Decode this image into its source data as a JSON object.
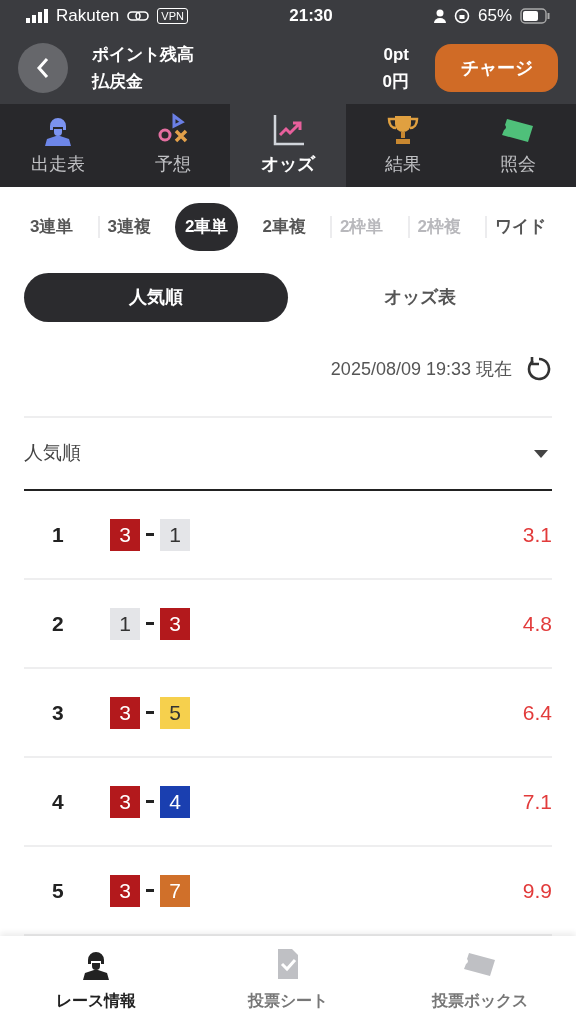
{
  "status_bar": {
    "carrier": "Rakuten",
    "vpn": "VPN",
    "time": "21:30",
    "battery": "65%"
  },
  "header": {
    "rows": [
      {
        "label": "ポイント残高",
        "value": "0pt"
      },
      {
        "label": "払戻金",
        "value": "0円"
      }
    ],
    "charge_button": "チャージ"
  },
  "top_nav": [
    {
      "label": "出走表",
      "selected": false
    },
    {
      "label": "予想",
      "selected": false
    },
    {
      "label": "オッズ",
      "selected": true
    },
    {
      "label": "結果",
      "selected": false
    },
    {
      "label": "照会",
      "selected": false
    }
  ],
  "bet_types": [
    {
      "label": "3連単",
      "selected": false,
      "disabled": false
    },
    {
      "label": "3連複",
      "selected": false,
      "disabled": false
    },
    {
      "label": "2車単",
      "selected": true,
      "disabled": false
    },
    {
      "label": "2車複",
      "selected": false,
      "disabled": false
    },
    {
      "label": "2枠単",
      "selected": false,
      "disabled": true
    },
    {
      "label": "2枠複",
      "selected": false,
      "disabled": true
    },
    {
      "label": "ワイド",
      "selected": false,
      "disabled": false
    }
  ],
  "view_toggle": [
    {
      "label": "人気順",
      "selected": true
    },
    {
      "label": "オッズ表",
      "selected": false
    }
  ],
  "timestamp": "2025/08/09 19:33 現在",
  "sort_select": {
    "value": "人気順"
  },
  "rows": [
    {
      "rank": "1",
      "first": {
        "number": "3",
        "color": "#b3191c"
      },
      "second": {
        "number": "1",
        "color": "#e4e5e8"
      },
      "odds": "3.1"
    },
    {
      "rank": "2",
      "first": {
        "number": "1",
        "color": "#e4e5e8"
      },
      "second": {
        "number": "3",
        "color": "#b3191c"
      },
      "odds": "4.8"
    },
    {
      "rank": "3",
      "first": {
        "number": "3",
        "color": "#b3191c"
      },
      "second": {
        "number": "5",
        "color": "#f6d04d"
      },
      "odds": "6.4"
    },
    {
      "rank": "4",
      "first": {
        "number": "3",
        "color": "#b3191c"
      },
      "second": {
        "number": "4",
        "color": "#1a3fb0"
      },
      "odds": "7.1"
    },
    {
      "rank": "5",
      "first": {
        "number": "3",
        "color": "#b3191c"
      },
      "second": {
        "number": "7",
        "color": "#d0702a"
      },
      "odds": "9.9"
    }
  ],
  "bottom_nav": [
    {
      "label": "レース情報",
      "selected": true
    },
    {
      "label": "投票シート",
      "selected": false
    },
    {
      "label": "投票ボックス",
      "selected": false
    }
  ]
}
